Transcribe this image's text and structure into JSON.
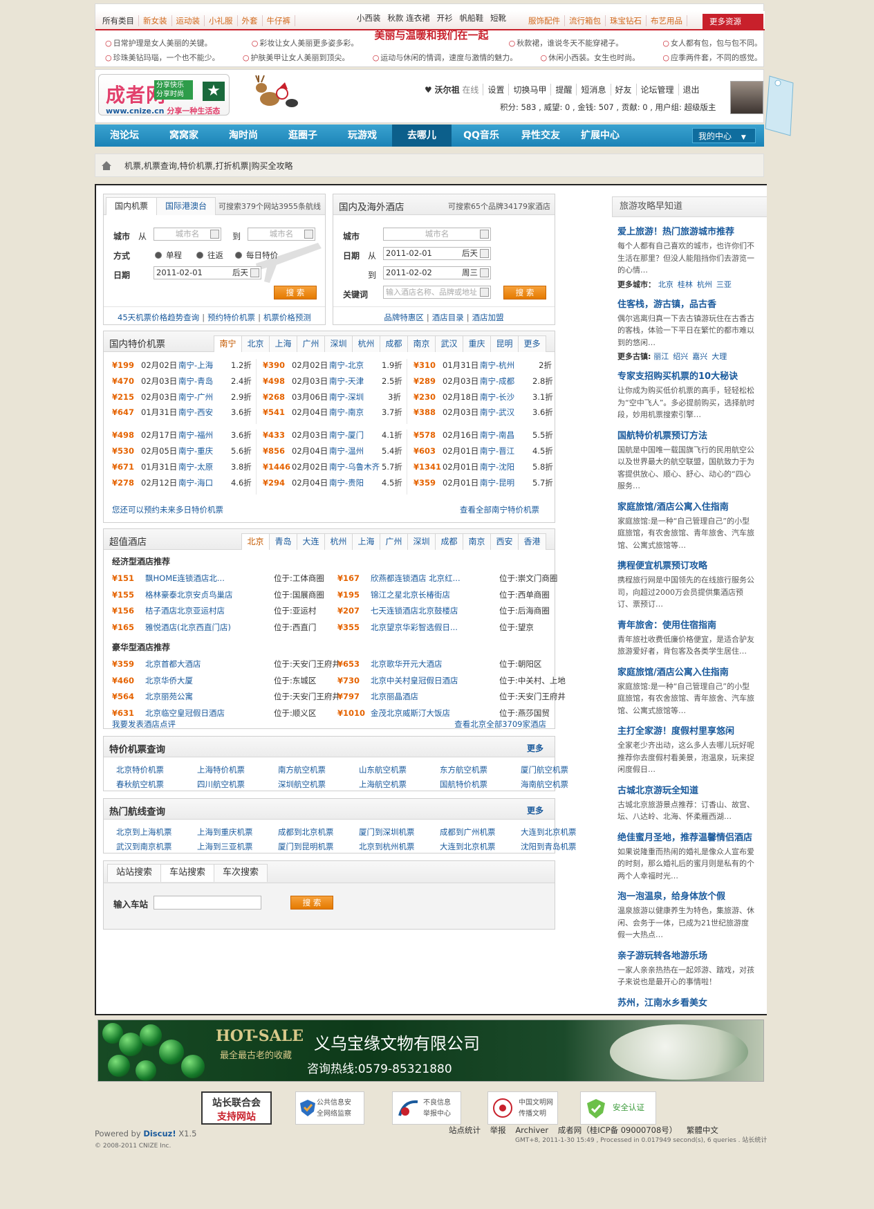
{
  "topbar": {
    "cats_left": [
      "所有类目",
      "新女装",
      "运动装",
      "小礼服",
      "外套",
      "牛仔裤"
    ],
    "cats_mid_row1": [
      "小西装",
      "秋款 连衣裙",
      "开衫",
      "帆船鞋",
      "短靴"
    ],
    "slogan": "美丽与温暖和我们在一起",
    "cats_right": [
      "服饰配件",
      "流行箱包",
      "珠宝钻石",
      "布艺用品"
    ],
    "more": "更多资源",
    "tips_row1": [
      "日常护理是女人美丽的关键。",
      "彩妆让女人美丽更多姿多彩。",
      "秋款裙，谁说冬天不能穿裙子。",
      "女人都有包，包与包不同。"
    ],
    "tips_row2": [
      "珍珠美钻玛瑙，一个也不能少。",
      "护肤美甲让女人美丽到顶尖。",
      "运动与休闲的情调，速度与激情的魅力。",
      "休闲小西装。女生也时尚。",
      "应季两件套，不同的感觉。"
    ]
  },
  "header": {
    "logo_cn": "成者网",
    "logo_tag1": "分享快乐",
    "logo_tag2": "分享时尚",
    "logo_url": "www.cnize.cn",
    "logo_slogan": "分享一种生活态",
    "user": "沃尔祖",
    "status": "在线",
    "links": [
      "设置",
      "切换马甲",
      "提醒",
      "短消息",
      "好友",
      "论坛管理",
      "退出"
    ],
    "stats": "积分: 583 , 威望: 0 , 金钱: 507 , 贡献: 0 , 用户组: 超级版主"
  },
  "nav": {
    "items": [
      "泡论坛",
      "窝窝家",
      "淘时尚",
      "逛圈子",
      "玩游戏",
      "去哪儿",
      "QQ音乐",
      "异性交友",
      "扩展中心"
    ],
    "current": "去哪儿",
    "my": "我的中心"
  },
  "breadcrumb": "机票,机票查询,特价机票,打折机票|购买全攻略",
  "flight_search": {
    "tabs": [
      "国内机票",
      "国际港澳台"
    ],
    "summary": "可搜索379个网站3955条航线",
    "city_label": "城市",
    "from_label": "从",
    "to_label": "到",
    "city_ph": "城市名",
    "mode_label": "方式",
    "modes": [
      "单程",
      "往返",
      "每日特价"
    ],
    "date_label": "日期",
    "date": "2011-02-01",
    "date_wd": "后天",
    "search": "搜 索",
    "foot_links": [
      "45天机票价格趋势查询",
      "预约特价机票",
      "机票价格预测"
    ]
  },
  "hotel_search": {
    "title": "国内及海外酒店",
    "summary": "可搜索65个品牌34179家酒店",
    "city_label": "城市",
    "city_ph": "城市名",
    "date_label": "日期",
    "from_label": "从",
    "to_label": "到",
    "checkin": "2011-02-01",
    "checkin_wd": "后天",
    "checkout": "2011-02-02",
    "checkout_wd": "周三",
    "kw_label": "关键词",
    "kw_ph": "输入酒店名称、品牌或地址",
    "search": "搜 索",
    "foot_links": [
      "品牌特惠区",
      "酒店目录",
      "酒店加盟"
    ]
  },
  "cheap_flights": {
    "title": "国内特价机票",
    "cities": [
      "南宁",
      "北京",
      "上海",
      "广州",
      "深圳",
      "杭州",
      "成都",
      "南京",
      "武汉",
      "重庆",
      "昆明",
      "更多"
    ],
    "col1": [
      [
        "¥199",
        "02月02日",
        "南宁-上海",
        "1.2折"
      ],
      [
        "¥470",
        "02月03日",
        "南宁-青岛",
        "2.4折"
      ],
      [
        "¥215",
        "02月03日",
        "南宁-广州",
        "2.9折"
      ],
      [
        "¥647",
        "01月31日",
        "南宁-西安",
        "3.6折"
      ],
      [
        "¥498",
        "02月17日",
        "南宁-福州",
        "3.6折"
      ],
      [
        "¥530",
        "02月05日",
        "南宁-重庆",
        "5.6折"
      ],
      [
        "¥671",
        "01月31日",
        "南宁-太原",
        "3.8折"
      ],
      [
        "¥278",
        "02月12日",
        "南宁-海口",
        "4.6折"
      ]
    ],
    "col2": [
      [
        "¥390",
        "02月02日",
        "南宁-北京",
        "1.9折"
      ],
      [
        "¥498",
        "02月03日",
        "南宁-天津",
        "2.5折"
      ],
      [
        "¥268",
        "03月06日",
        "南宁-深圳",
        "3折"
      ],
      [
        "¥541",
        "02月04日",
        "南宁-南京",
        "3.7折"
      ],
      [
        "¥433",
        "02月03日",
        "南宁-厦门",
        "4.1折"
      ],
      [
        "¥856",
        "02月04日",
        "南宁-温州",
        "5.4折"
      ],
      [
        "¥1446",
        "02月02日",
        "南宁-乌鲁木齐",
        "5.7折"
      ],
      [
        "¥294",
        "02月04日",
        "南宁-贵阳",
        "4.5折"
      ]
    ],
    "col3": [
      [
        "¥310",
        "01月31日",
        "南宁-杭州",
        "2折"
      ],
      [
        "¥289",
        "02月03日",
        "南宁-成都",
        "2.8折"
      ],
      [
        "¥230",
        "02月18日",
        "南宁-长沙",
        "3.1折"
      ],
      [
        "¥388",
        "02月03日",
        "南宁-武汉",
        "3.6折"
      ],
      [
        "¥578",
        "02月16日",
        "南宁-南昌",
        "5.5折"
      ],
      [
        "¥603",
        "02月01日",
        "南宁-晋江",
        "4.5折"
      ],
      [
        "¥1341",
        "02月01日",
        "南宁-沈阳",
        "5.8折"
      ],
      [
        "¥359",
        "02月01日",
        "南宁-昆明",
        "5.7折"
      ]
    ],
    "foot_left": "您还可以预约未来多日特价机票",
    "foot_right": "查看全部南宁特价机票"
  },
  "hotels": {
    "title": "超值酒店",
    "cities": [
      "北京",
      "青岛",
      "大连",
      "杭州",
      "上海",
      "广州",
      "深圳",
      "成都",
      "南京",
      "西安",
      "香港"
    ],
    "econ_title": "经济型酒店推荐",
    "econ_left": [
      [
        "¥151",
        "飘HOME连锁酒店北...",
        "位于:工体商圈"
      ],
      [
        "¥155",
        "格林豪泰北京安贞鸟巢店",
        "位于:国展商圈"
      ],
      [
        "¥156",
        "桔子酒店北京亚运村店",
        "位于:亚运村"
      ],
      [
        "¥165",
        "雅悦酒店(北京西直门店)",
        "位于:西直门"
      ]
    ],
    "econ_right": [
      [
        "¥167",
        "欣燕都连锁酒店 北京红...",
        "位于:崇文门商圈"
      ],
      [
        "¥195",
        "锦江之星北京长椿街店",
        "位于:西单商圈"
      ],
      [
        "¥207",
        "七天连锁酒店北京鼓楼店",
        "位于:后海商圈"
      ],
      [
        "¥355",
        "北京望京华彩智选假日...",
        "位于:望京"
      ]
    ],
    "lux_title": "豪华型酒店推荐",
    "lux_left": [
      [
        "¥359",
        "北京首都大酒店",
        "位于:天安门王府井"
      ],
      [
        "¥460",
        "北京华侨大厦",
        "位于:东城区"
      ],
      [
        "¥564",
        "北京丽苑公寓",
        "位于:天安门王府井"
      ],
      [
        "¥631",
        "北京临空皇冠假日酒店",
        "位于:顺义区"
      ]
    ],
    "lux_right": [
      [
        "¥653",
        "北京歌华开元大酒店",
        "位于:朝阳区"
      ],
      [
        "¥730",
        "北京中关村皇冠假日酒店",
        "位于:中关村、上地"
      ],
      [
        "¥797",
        "北京丽晶酒店",
        "位于:天安门王府井"
      ],
      [
        "¥1010",
        "金茂北京威斯汀大饭店",
        "位于:燕莎国贸"
      ]
    ],
    "foot_left": "我要发表酒店点评",
    "foot_right": "查看北京全部3709家酒店"
  },
  "flight_query": {
    "title": "特价机票查询",
    "more": "更多",
    "links": [
      "北京特价机票",
      "上海特价机票",
      "南方航空机票",
      "山东航空机票",
      "东方航空机票",
      "厦门航空机票",
      "春秋航空机票",
      "四川航空机票",
      "深圳航空机票",
      "上海航空机票",
      "国航特价机票",
      "海南航空机票"
    ]
  },
  "route_query": {
    "title": "热门航线查询",
    "more": "更多",
    "links": [
      "北京到上海机票",
      "上海到重庆机票",
      "成都到北京机票",
      "厦门到深圳机票",
      "成都到广州机票",
      "大连到北京机票",
      "武汉到南京机票",
      "上海到三亚机票",
      "厦门到昆明机票",
      "北京到杭州机票",
      "大连到北京机票",
      "沈阳到青岛机票"
    ]
  },
  "train": {
    "tabs": [
      "站站搜索",
      "车站搜索",
      "车次搜索"
    ],
    "label": "输入车站",
    "search": "搜 索"
  },
  "side": {
    "title": "旅游攻略早知道",
    "articles": [
      {
        "h": "爱上旅游！热门旅游城市推荐",
        "p": "每个人都有自己喜欢的城市，也许你们不生活在那里？但没人能阻挡你们去游览一的心情…",
        "more_label": "更多城市：",
        "more": [
          "北京",
          "桂林",
          "杭州",
          "三亚"
        ]
      },
      {
        "h": "住客栈，游古镇，品古香",
        "p": "偶尔逃离归真一下去古镇游玩住在古香古的客栈，体验一下平日在繁忙的都市难以到的悠闲…",
        "more_label": "更多古镇:",
        "more": [
          "丽江",
          "绍兴",
          "嘉兴",
          "大理"
        ]
      },
      {
        "h": "专家支招购买机票的10大秘诀",
        "p": "让你成为购买低价机票的高手，轻轻松松为“空中飞人”。多必提前购买，选择航时段，妙用机票搜索引擎…"
      },
      {
        "h": "国航特价机票预订方法",
        "p": "国航是中国唯一载国旗飞行的民用航空公以及世界最大的航空联盟，国航致力于为客提供放心、顺心、舒心、动心的“四心服务…"
      },
      {
        "h": "家庭旅馆/酒店公寓入住指南",
        "p": "家庭旅馆:是一种“自己管理自己”的小型庭旅馆，有农舍旅馆、青年旅舍、汽车旅馆、公寓式旅馆等…"
      },
      {
        "h": "携程便宜机票预订攻略",
        "p": "携程旅行网是中国领先的在线旅行服务公司，向超过2000万会员提供集酒店预订、票预订…"
      },
      {
        "h": "青年旅舍：使用住宿指南",
        "p": "青年旅社收费低廉价格便宜，是适合驴友旅游爱好者，背包客及各类学生居住…"
      },
      {
        "h": "家庭旅馆/酒店公寓入住指南",
        "p": "家庭旅馆:是一种“自己管理自己”的小型庭旅馆，有农舍旅馆、青年旅舍、汽车旅馆、公寓式旅馆等…"
      },
      {
        "h": "主打全家游！度假村里享悠闲",
        "p": "全家老少齐出动，这么多人去哪儿玩好呢推荐你去度假村看美景，泡温泉，玩来捉闲度假日…"
      },
      {
        "h": "古城北京游玩全知道",
        "p": "古城北京旅游景点推荐：订香山、故宫、坛、八达岭、北海、怀柔雁西湖…"
      },
      {
        "h": "绝佳蜜月圣地，推荐温馨情侣酒店",
        "p": "如果说隆重而热闹的婚礼是像众人宣布爱的时刻，那么婚礼后的蜜月则是私有的个两个人幸福时光…"
      },
      {
        "h": "泡一泡温泉，给身体放个假",
        "p": "温泉旅游以健康养生为特色，集旅游、休闲、会务于一体，已成为21世纪旅游度假一大热点…"
      },
      {
        "h": "亲子游玩转各地游乐场",
        "p": "一家人亲亲热热在一起郊游、踏戏，对孩子来说也是最开心的事情啦！"
      },
      {
        "h": "苏州，江南水乡看美女",
        "p": ""
      }
    ]
  },
  "banner": {
    "hot": "HOT-SALE",
    "hot_sub": "最全最古老的收藏",
    "company": "义乌宝缘文物有限公司",
    "tel": "咨询热线:0579-85321880"
  },
  "footer": {
    "badges": [
      {
        "t1": "站长联合会",
        "t2": "支持网站"
      },
      {
        "t1": "公共信息安",
        "t2": "全网络监察"
      },
      {
        "t1": "不良信息",
        "t2": "举报中心"
      },
      {
        "t1": "中国文明网",
        "t2": "传播文明"
      },
      {
        "t1": "安全认证",
        "t2": ""
      }
    ],
    "powered_pre": "Powered by",
    "powered_brand": "Discuz!",
    "powered_ver": "X1.5",
    "copyright": "© 2008-2011 CNIZE Inc.",
    "links": [
      "站点统计",
      "举报",
      "Archiver",
      "成者网（桂ICP备 09000708号）",
      "繁體中文"
    ],
    "gmt": "GMT+8, 2011-1-30 15:49 , Processed in 0.017949 second(s), 6 queries . 站长统计"
  }
}
